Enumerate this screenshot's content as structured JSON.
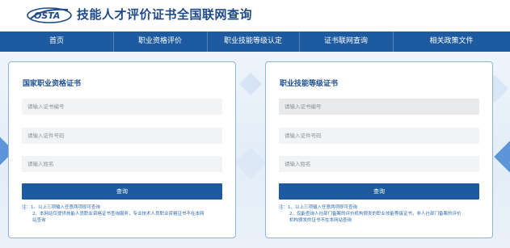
{
  "header": {
    "logo_text": "OSTA",
    "title": "技能人才评价证书全国联网查询"
  },
  "nav": {
    "items": [
      {
        "label": "首页"
      },
      {
        "label": "职业资格评价"
      },
      {
        "label": "职业技能等级认定"
      },
      {
        "label": "证书联网查询"
      },
      {
        "label": "相关政策文件"
      }
    ]
  },
  "left_card": {
    "title": "国家职业资格证书",
    "cert_no_placeholder": "请输入证书编号",
    "id_no_placeholder": "请输入证件号码",
    "name_placeholder": "请输入姓名",
    "query_label": "查询",
    "notes": {
      "line1": "注：1、以上三项输入任意两项即可查询",
      "line2": "2、本网站仅提供技能人员职业资格证书查询服务，专业技术人员职业资格证书不在本网",
      "line3": "站查询"
    }
  },
  "right_card": {
    "title": "职业技能等级证书",
    "cert_no_placeholder": "请输入证书编号",
    "id_no_placeholder": "请输入证件号码",
    "name_placeholder": "请输入姓名",
    "query_label": "查询",
    "notes": {
      "line1": "注：1、以上三项输入任意两项即可查询",
      "line2": "2、仅能查询人社部门备案的评价机构颁发的职业技能等级证书，非人社部门备案的评价",
      "line3": "机构颁发的证书不在本网站查询"
    }
  },
  "colors": {
    "brand_blue": "#1e5aa0",
    "title_blue": "#1f4a8a",
    "card_border": "#8fb3de",
    "note_blue": "#2f6ab3"
  }
}
